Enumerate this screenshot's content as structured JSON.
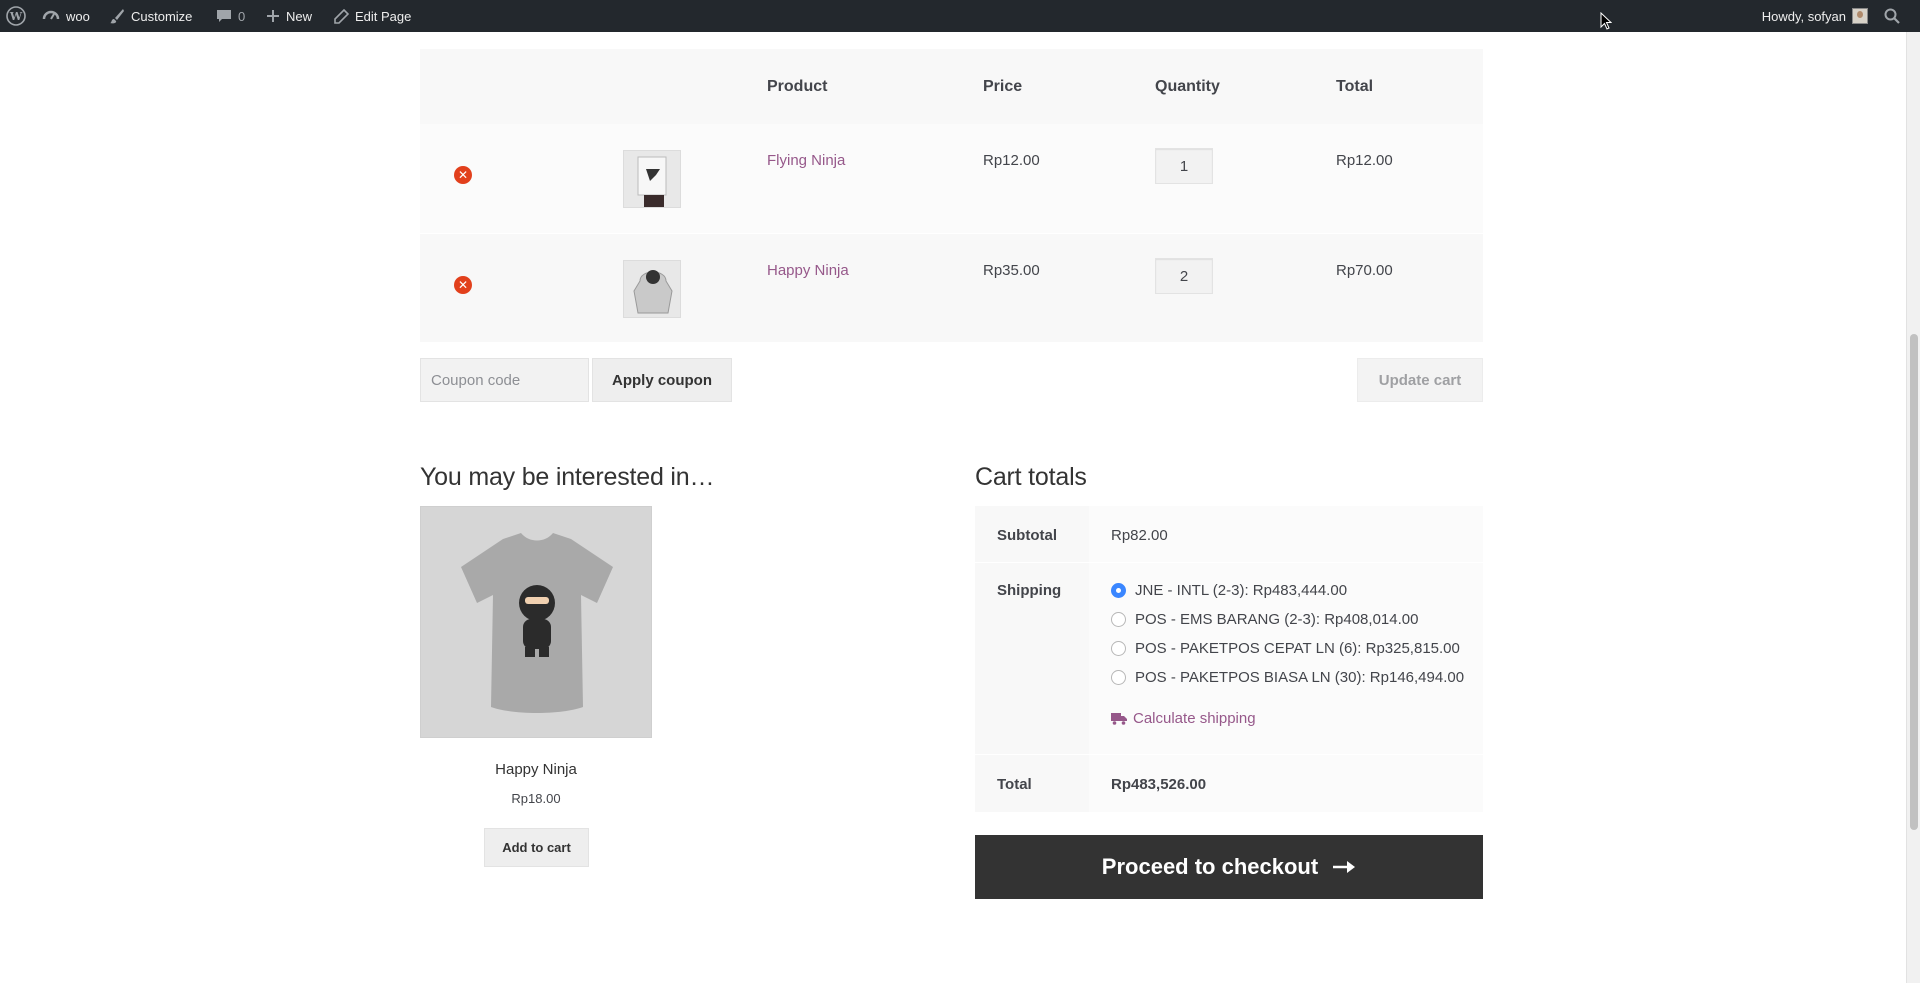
{
  "admin_bar": {
    "site_name": "woo",
    "customize": "Customize",
    "comments_count": "0",
    "new": "New",
    "edit_page": "Edit Page",
    "howdy": "Howdy, sofyan"
  },
  "cart": {
    "columns": {
      "product": "Product",
      "price": "Price",
      "quantity": "Quantity",
      "total": "Total"
    },
    "items": [
      {
        "name": "Flying Ninja",
        "price": "Rp12.00",
        "quantity": "1",
        "total": "Rp12.00"
      },
      {
        "name": "Happy Ninja",
        "price": "Rp35.00",
        "quantity": "2",
        "total": "Rp70.00"
      }
    ],
    "coupon_placeholder": "Coupon code",
    "apply_coupon": "Apply coupon",
    "update_cart": "Update cart"
  },
  "cross_sells": {
    "title": "You may be interested in…",
    "product": {
      "name": "Happy Ninja",
      "price": "Rp18.00",
      "button": "Add to cart"
    }
  },
  "cart_totals": {
    "title": "Cart totals",
    "subtotal_label": "Subtotal",
    "subtotal": "Rp82.00",
    "shipping_label": "Shipping",
    "shipping_options": [
      {
        "label": "JNE - INTL (2-3): Rp483,444.00",
        "selected": true
      },
      {
        "label": "POS - EMS BARANG (2-3): Rp408,014.00",
        "selected": false
      },
      {
        "label": "POS - PAKETPOS CEPAT LN (6): Rp325,815.00",
        "selected": false
      },
      {
        "label": "POS - PAKETPOS BIASA LN (30): Rp146,494.00",
        "selected": false
      }
    ],
    "calculate_shipping": "Calculate shipping",
    "total_label": "Total",
    "total": "Rp483,526.00",
    "checkout": "Proceed to checkout"
  },
  "colors": {
    "admin_bar_bg": "#23282d",
    "link": "#96588a",
    "remove": "#e2401c",
    "checkout_bg": "#333333",
    "radio_selected": "#3a86ff"
  }
}
